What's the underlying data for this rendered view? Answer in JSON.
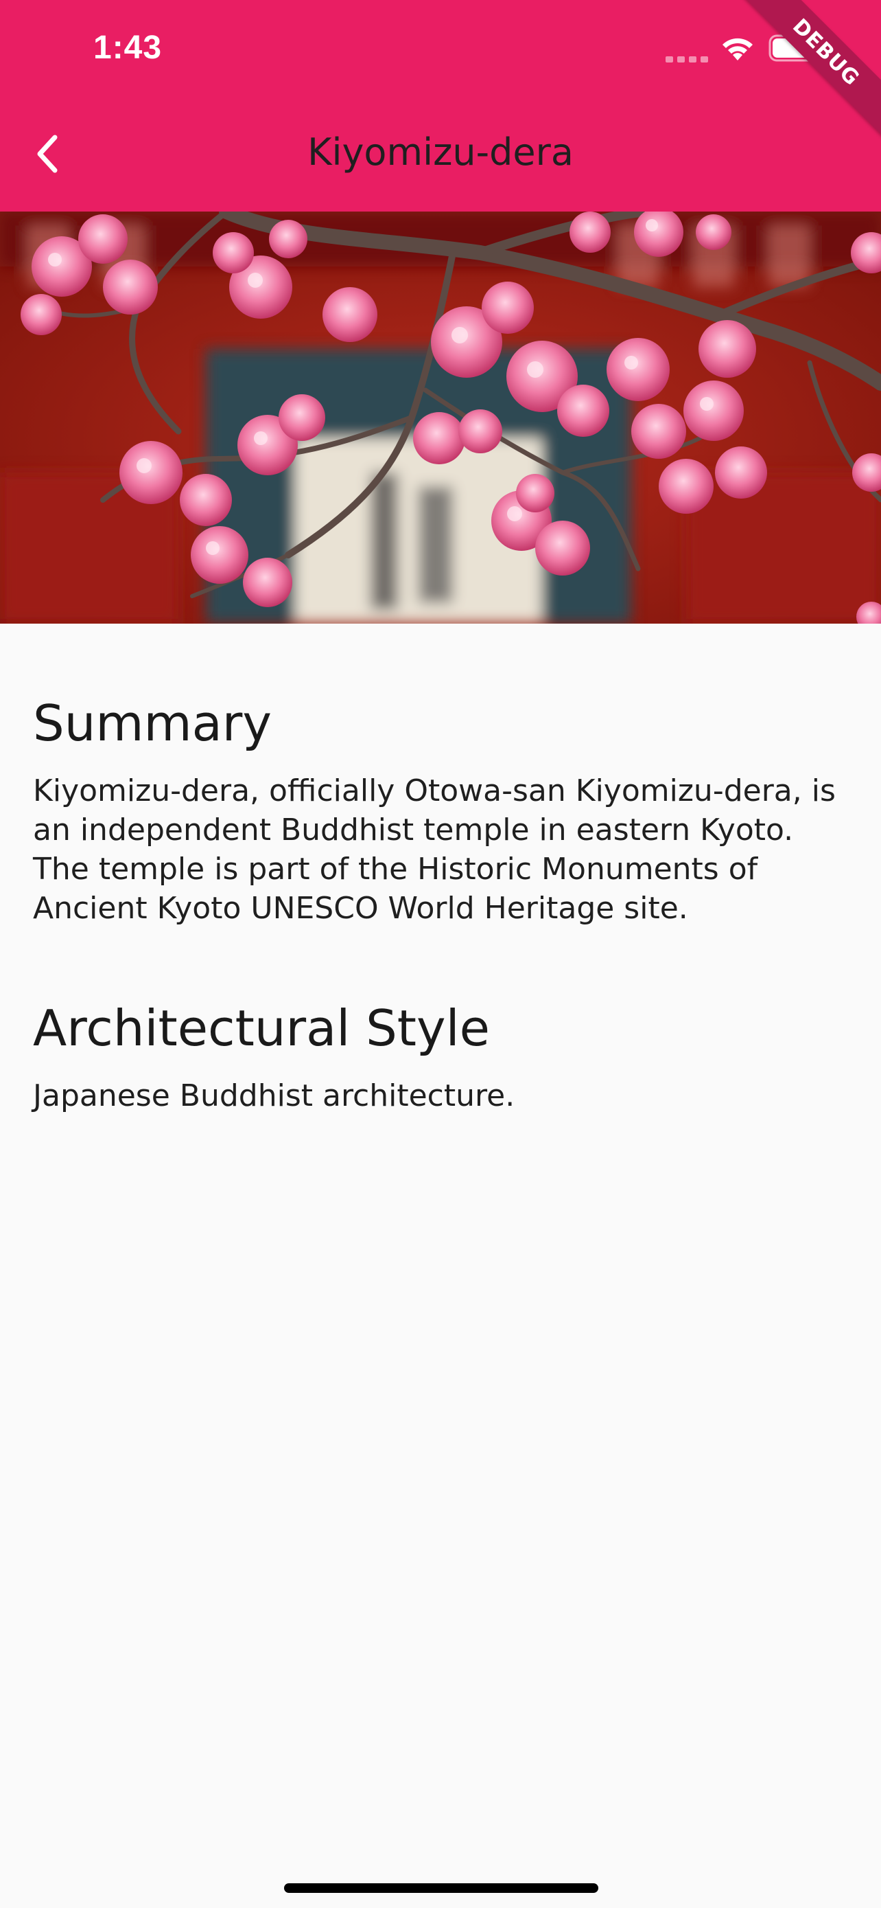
{
  "status_bar": {
    "time": "1:43"
  },
  "debug_banner": {
    "label": "DEBUG"
  },
  "app_bar": {
    "title": "Kiyomizu-dera",
    "back_icon": "chevron-left-icon",
    "background_color": "#e91e63"
  },
  "hero": {
    "subject": "Pink plum blossoms on branches in front of a red temple gate"
  },
  "sections": [
    {
      "heading": "Summary",
      "body": "Kiyomizu-dera, officially Otowa-san Kiyomizu-dera, is an independent Buddhist temple in eastern Kyoto. The temple is part of the Historic Monuments of Ancient Kyoto UNESCO World Heritage site."
    },
    {
      "heading": "Architectural Style",
      "body": "Japanese Buddhist architecture."
    }
  ]
}
